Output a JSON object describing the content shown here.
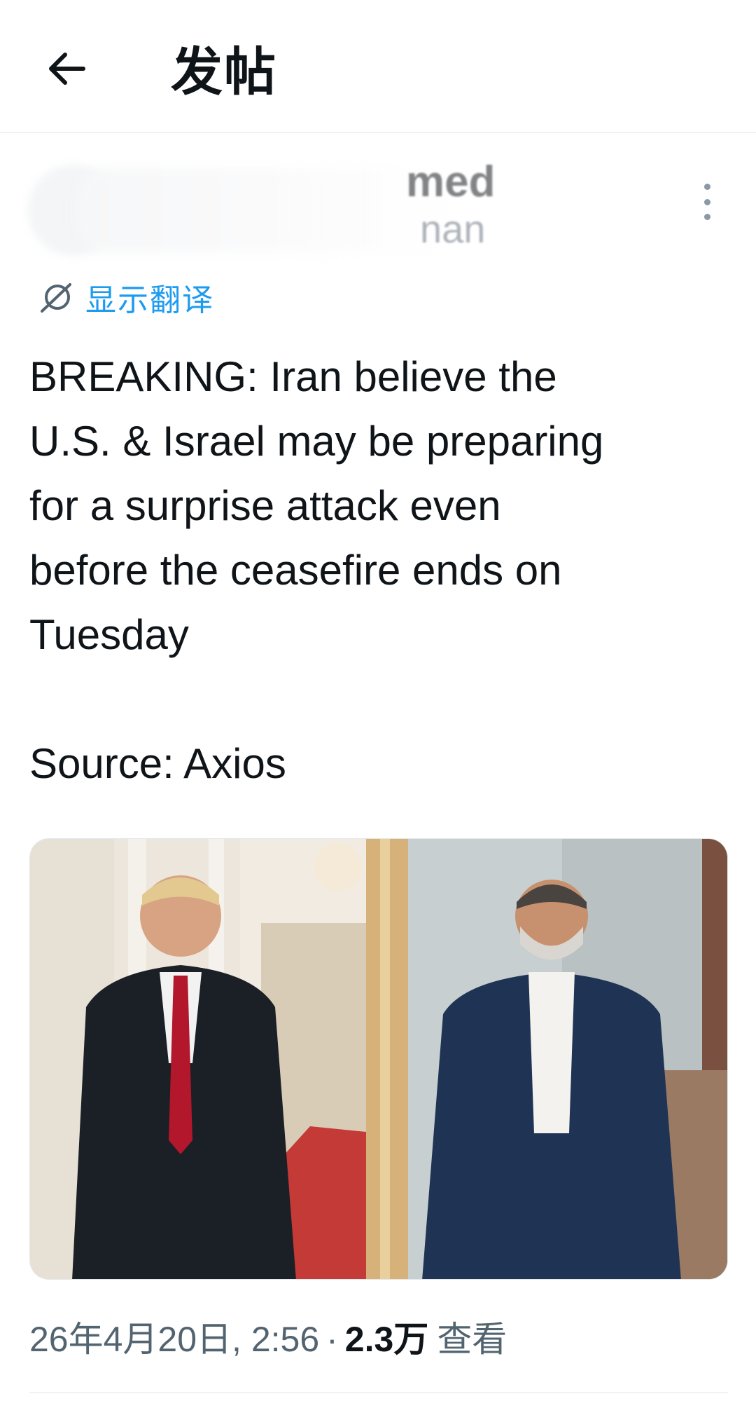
{
  "header": {
    "back_icon": "arrow-left-icon",
    "title": "发帖"
  },
  "author": {
    "name_visible": "med",
    "handle_visible": "nan",
    "more_icon": "more-vertical-icon"
  },
  "translate": {
    "icon": "globe-slash-icon",
    "label": "显示翻译",
    "color": "#1d9bf0"
  },
  "tweet": {
    "text": "BREAKING: Iran believe the\nU.S. & Israel may be preparing\nfor a surprise attack even\nbefore the ceasefire ends on\nTuesday",
    "source": "Source: Axios"
  },
  "media": {
    "image_icon": "photo-icon"
  },
  "meta": {
    "datetime": "26年4月20日, 2:56",
    "separator": "·",
    "views_count": "2.3万",
    "views_label": "查看"
  }
}
